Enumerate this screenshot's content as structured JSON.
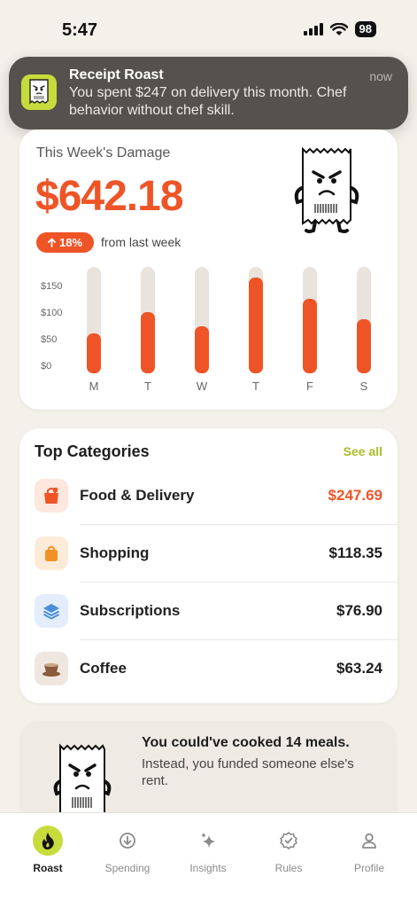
{
  "status_bar": {
    "time": "5:47",
    "battery": "98"
  },
  "notification": {
    "app_name": "Receipt Roast",
    "time": "now",
    "body": "You spent $247 on delivery this month. Chef behavior without chef skill."
  },
  "week_card": {
    "title": "This Week's Damage",
    "total": "$642.18",
    "change_pct": "18%",
    "change_caption": "from last week",
    "chart_data": {
      "type": "bar",
      "categories": [
        "M",
        "T",
        "W",
        "T",
        "F",
        "S"
      ],
      "values": [
        75,
        115,
        88,
        180,
        140,
        102
      ],
      "y_ticks": [
        "$150",
        "$100",
        "$50",
        "$0"
      ],
      "ylim": [
        0,
        200
      ]
    }
  },
  "categories": {
    "title": "Top Categories",
    "see_all": "See all",
    "items": [
      {
        "name": "Food & Delivery",
        "amount": "$247.69",
        "icon": "takeout-bag-icon",
        "icon_bg": "#fde7df",
        "icon_color": "#ef5427"
      },
      {
        "name": "Shopping",
        "amount": "$118.35",
        "icon": "shopping-bag-icon",
        "icon_bg": "#fdebd9",
        "icon_color": "#f39224"
      },
      {
        "name": "Subscriptions",
        "amount": "$76.90",
        "icon": "layers-icon",
        "icon_bg": "#e3edfb",
        "icon_color": "#4a8ed9"
      },
      {
        "name": "Coffee",
        "amount": "$63.24",
        "icon": "coffee-cup-icon",
        "icon_bg": "#efe7df",
        "icon_color": "#8a5a3c"
      }
    ]
  },
  "roast_card": {
    "headline": "You could've cooked 14 meals.",
    "sub": "Instead, you funded someone else's rent."
  },
  "tab_bar": {
    "tabs": [
      {
        "label": "Roast",
        "icon": "flame-icon"
      },
      {
        "label": "Spending",
        "icon": "down-arrow-circle-icon"
      },
      {
        "label": "Insights",
        "icon": "sparkle-icon"
      },
      {
        "label": "Rules",
        "icon": "badge-check-icon"
      },
      {
        "label": "Profile",
        "icon": "person-icon"
      }
    ]
  },
  "colors": {
    "accent": "#ef5427",
    "brand_lime": "#c6dc3c",
    "background": "#f4f0ea"
  }
}
